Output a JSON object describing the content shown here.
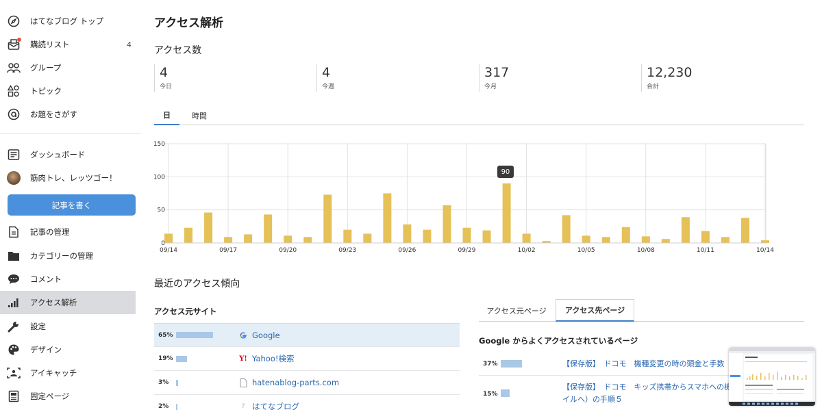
{
  "sidebar": {
    "items": [
      {
        "label": "はてなブログ トップ",
        "icon": "compass-icon"
      },
      {
        "label": "購読リスト",
        "icon": "mail-icon",
        "count": "4"
      },
      {
        "label": "グループ",
        "icon": "group-icon"
      },
      {
        "label": "トピック",
        "icon": "shapes-icon"
      },
      {
        "label": "お題をさがす",
        "icon": "at-icon"
      }
    ],
    "items2": [
      {
        "label": "ダッシュボード",
        "icon": "dashboard-icon"
      },
      {
        "label": "筋肉トレ、レッツゴー！",
        "icon": "avatar"
      }
    ],
    "write_button": "記事を書く",
    "items3": [
      {
        "label": "記事の管理",
        "icon": "document-icon"
      },
      {
        "label": "カテゴリーの管理",
        "icon": "folder-icon"
      },
      {
        "label": "コメント",
        "icon": "comment-icon"
      },
      {
        "label": "アクセス解析",
        "icon": "signal-icon"
      },
      {
        "label": "設定",
        "icon": "wrench-icon"
      },
      {
        "label": "デザイン",
        "icon": "palette-icon"
      },
      {
        "label": "アイキャッチ",
        "icon": "image-icon"
      },
      {
        "label": "固定ページ",
        "icon": "page-icon"
      }
    ]
  },
  "main": {
    "title": "アクセス解析",
    "access_section": "アクセス数",
    "stats": [
      {
        "value": "4",
        "label": "今日"
      },
      {
        "value": "4",
        "label": "今週"
      },
      {
        "value": "317",
        "label": "今月"
      },
      {
        "value": "12,230",
        "label": "合計"
      }
    ],
    "tabs": [
      {
        "label": "日"
      },
      {
        "label": "時間"
      }
    ],
    "trend_section": "最近のアクセス傾向",
    "referrer_title": "アクセス元サイト",
    "referrers": [
      {
        "pct": "65%",
        "value": 65,
        "name": "Google",
        "icon": "google-icon"
      },
      {
        "pct": "19%",
        "value": 19,
        "name": "Yahoo!検索",
        "icon": "yahoo-icon"
      },
      {
        "pct": "3%",
        "value": 3,
        "name": "hatenablog-parts.com",
        "icon": "page-icon"
      },
      {
        "pct": "2%",
        "value": 2,
        "name": "はてなブログ",
        "icon": "hatena-icon"
      }
    ],
    "right_tabs": [
      {
        "label": "アクセス元ページ"
      },
      {
        "label": "アクセス先ページ"
      }
    ],
    "dest_title": "Google からよくアクセスされているページ",
    "destinations": [
      {
        "pct": "37%",
        "value": 37,
        "title_line1": "【保存版】　ドコモ　機種変更の時の頭金と手数"
      },
      {
        "pct": "15%",
        "value": 15,
        "title_line1": "【保存版】　ドコモ　キッズ携帯からスマホへの機",
        "title_line2": "イルへ）の手順５"
      }
    ]
  },
  "chart_data": {
    "type": "bar",
    "color": "#e5c158",
    "ylim": [
      0,
      150
    ],
    "yticks": [
      0,
      50,
      100,
      150
    ],
    "tick_labels": [
      "09/14",
      "09/17",
      "09/20",
      "09/23",
      "09/26",
      "09/29",
      "10/02",
      "10/05",
      "10/08",
      "10/11",
      "10/14"
    ],
    "categories": [
      "09/14",
      "09/15",
      "09/16",
      "09/17",
      "09/18",
      "09/19",
      "09/20",
      "09/21",
      "09/22",
      "09/23",
      "09/24",
      "09/25",
      "09/26",
      "09/27",
      "09/28",
      "09/29",
      "09/30",
      "10/01",
      "10/02",
      "10/03",
      "10/04",
      "10/05",
      "10/06",
      "10/07",
      "10/08",
      "10/09",
      "10/10",
      "10/11",
      "10/12",
      "10/13",
      "10/14"
    ],
    "values": [
      14,
      23,
      46,
      9,
      13,
      43,
      11,
      9,
      73,
      20,
      14,
      75,
      28,
      20,
      57,
      23,
      19,
      90,
      14,
      3,
      42,
      11,
      9,
      24,
      10,
      6,
      39,
      18,
      9,
      38,
      4
    ],
    "tooltip": {
      "category": "10/01",
      "label": "90"
    }
  }
}
